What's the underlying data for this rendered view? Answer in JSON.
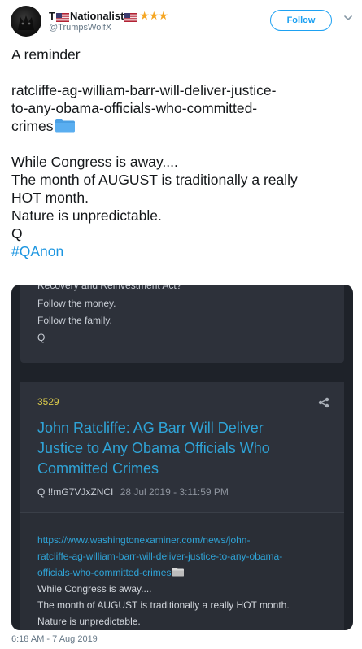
{
  "user": {
    "name": "T",
    "name_suffix": "Nationalist",
    "stars": "★★★",
    "handle": "@TrumpsWolfX"
  },
  "follow_label": "Follow",
  "tweet": {
    "line1": "A reminder",
    "link_line1": "ratcliffe-ag-william-barr-will-deliver-justice-",
    "link_line2": "to-any-obama-officials-who-committed-",
    "link_line3": "crimes",
    "body1": "While Congress is away....",
    "body2": "The month of AUGUST is traditionally a really",
    "body3": "HOT month.",
    "body4": "Nature is unpredictable.",
    "body5": "Q",
    "hashtag": "#QAnon"
  },
  "embed": {
    "card1": {
      "partial": "Recovery and Reinvestment Act?",
      "line1": "Follow the money.",
      "line2": "Follow the family.",
      "line3": "Q"
    },
    "card2": {
      "number": "3529",
      "title_line1": "John Ratcliffe: AG Barr Will Deliver",
      "title_line2": "Justice to Any Obama Officials Who",
      "title_line3": "Committed Crimes",
      "author": "Q",
      "tripcode": "!!mG7VJxZNCI",
      "date": "28 Jul 2019 - 3:11:59 PM",
      "link1": "https://www.washingtonexaminer.com/news/john-",
      "link2": "ratcliffe-ag-william-barr-will-deliver-justice-to-any-obama-",
      "link3": "officials-who-committed-crimes",
      "text1": "While Congress is away....",
      "text2": "The month of AUGUST is traditionally a really HOT month.",
      "text3": "Nature is unpredictable."
    }
  },
  "timestamp": "6:18 AM - 7 Aug 2019",
  "colors": {
    "accent": "#1da1f2",
    "hashtag": "#1b95e0",
    "embed_bg": "#1e2229",
    "card_bg": "#2d313a",
    "post_number": "#d8c84a",
    "post_link": "#2fa3d6",
    "stars": "#f5a623"
  },
  "icons": [
    "us-flag-icon",
    "star-icon",
    "folder-icon",
    "share-icon",
    "chevron-down-icon"
  ]
}
